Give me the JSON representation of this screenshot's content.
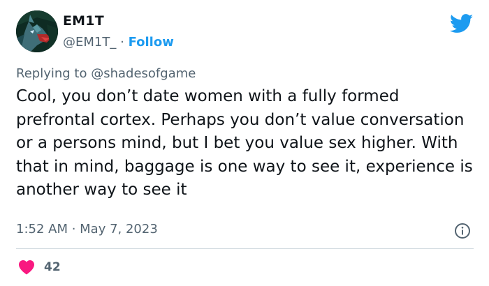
{
  "author": {
    "name": "EM1T",
    "handle": "@EM1T_",
    "separator": "·",
    "follow_label": "Follow",
    "avatar_icon": "wolf-avatar"
  },
  "reply": {
    "prefix": "Replying to",
    "mention": "@shadesofgame"
  },
  "tweet": {
    "text": "Cool, you don’t date women with a fully formed prefrontal cortex. Perhaps you don’t value conversation or a persons mind, but I bet you value sex higher. With that in mind, baggage is one way to see it, experience is another way to see it"
  },
  "meta": {
    "timestamp": "1:52 AM · May 7, 2023"
  },
  "stats": {
    "likes": "42"
  },
  "icons": {
    "brand": "twitter-bird-icon",
    "info": "info-icon",
    "like": "heart-icon"
  },
  "colors": {
    "brand": "#1d9bf0",
    "like": "#f91880",
    "secondary_text": "#536471"
  }
}
